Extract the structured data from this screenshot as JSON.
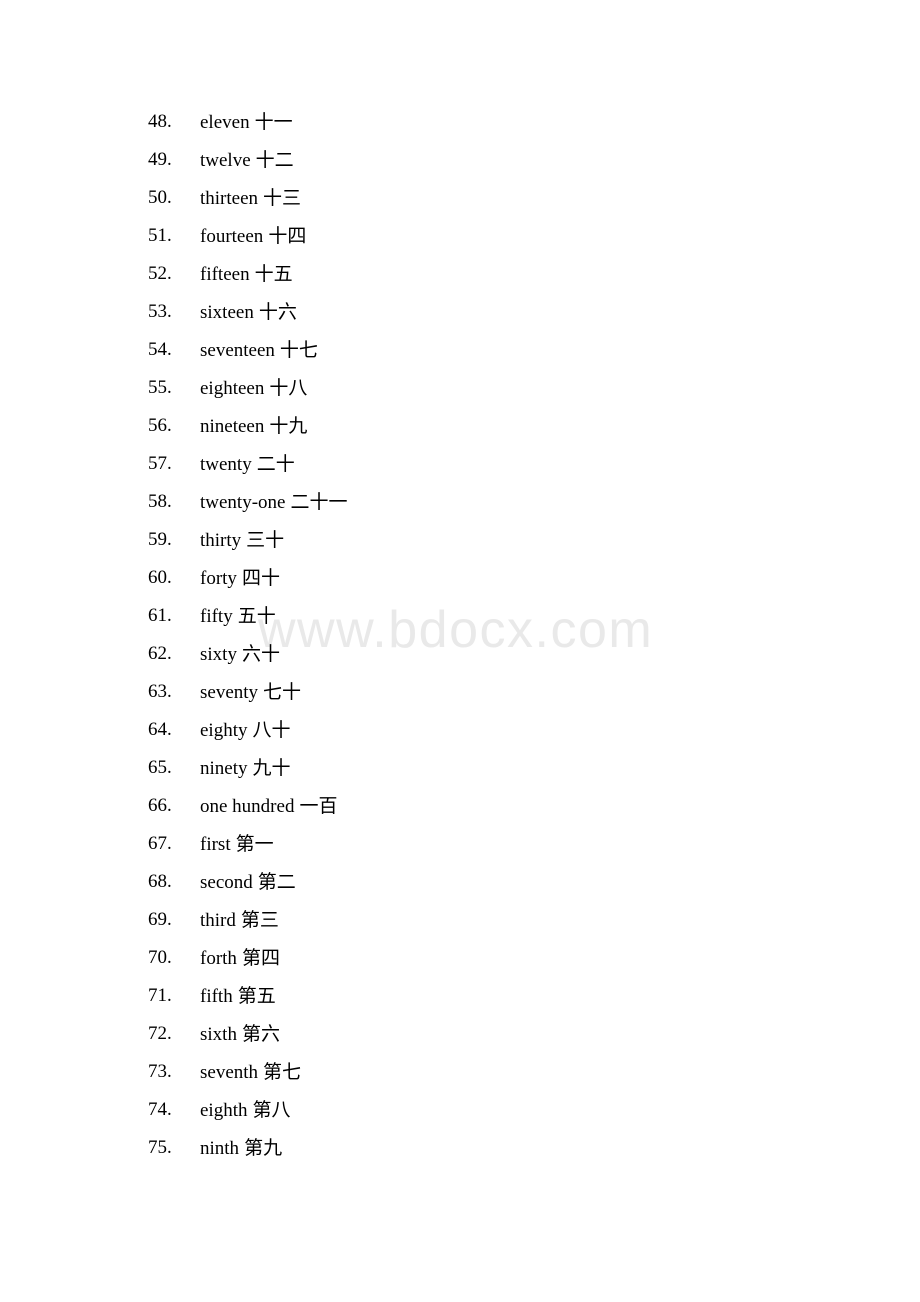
{
  "document": {
    "page_background": "#ffffff",
    "text_color": "#000000",
    "watermark": {
      "text": "www.bdocx.com",
      "color": "#e9e9e9"
    }
  },
  "list": {
    "entries": [
      {
        "number": "48.",
        "term": "eleven",
        "gloss": "十一"
      },
      {
        "number": "49.",
        "term": "twelve",
        "gloss": "十二"
      },
      {
        "number": "50.",
        "term": "thirteen",
        "gloss": "十三"
      },
      {
        "number": "51.",
        "term": "fourteen",
        "gloss": "十四"
      },
      {
        "number": "52.",
        "term": "fifteen",
        "gloss": "十五"
      },
      {
        "number": "53.",
        "term": "sixteen",
        "gloss": "十六"
      },
      {
        "number": "54.",
        "term": "seventeen",
        "gloss": "十七"
      },
      {
        "number": "55.",
        "term": "eighteen",
        "gloss": "十八"
      },
      {
        "number": "56.",
        "term": "nineteen",
        "gloss": "十九"
      },
      {
        "number": "57.",
        "term": "twenty",
        "gloss": "二十"
      },
      {
        "number": "58.",
        "term": "twenty-one",
        "gloss": "二十一"
      },
      {
        "number": "59.",
        "term": "thirty",
        "gloss": "三十"
      },
      {
        "number": "60.",
        "term": "forty",
        "gloss": "四十"
      },
      {
        "number": "61.",
        "term": "fifty",
        "gloss": "五十"
      },
      {
        "number": "62.",
        "term": "sixty",
        "gloss": "六十"
      },
      {
        "number": "63.",
        "term": "seventy",
        "gloss": "七十"
      },
      {
        "number": "64.",
        "term": "eighty",
        "gloss": "八十"
      },
      {
        "number": "65.",
        "term": "ninety",
        "gloss": "九十"
      },
      {
        "number": "66.",
        "term": "one hundred",
        "gloss": "一百"
      },
      {
        "number": "67.",
        "term": "first",
        "gloss": "第一"
      },
      {
        "number": "68.",
        "term": "second",
        "gloss": "第二"
      },
      {
        "number": "69.",
        "term": "third",
        "gloss": "第三"
      },
      {
        "number": "70.",
        "term": "forth",
        "gloss": "第四"
      },
      {
        "number": "71.",
        "term": "fifth",
        "gloss": "第五"
      },
      {
        "number": "72.",
        "term": "sixth",
        "gloss": "第六"
      },
      {
        "number": "73.",
        "term": "seventh",
        "gloss": "第七"
      },
      {
        "number": "74.",
        "term": "eighth",
        "gloss": "第八"
      },
      {
        "number": "75.",
        "term": "ninth",
        "gloss": "第九"
      }
    ]
  }
}
